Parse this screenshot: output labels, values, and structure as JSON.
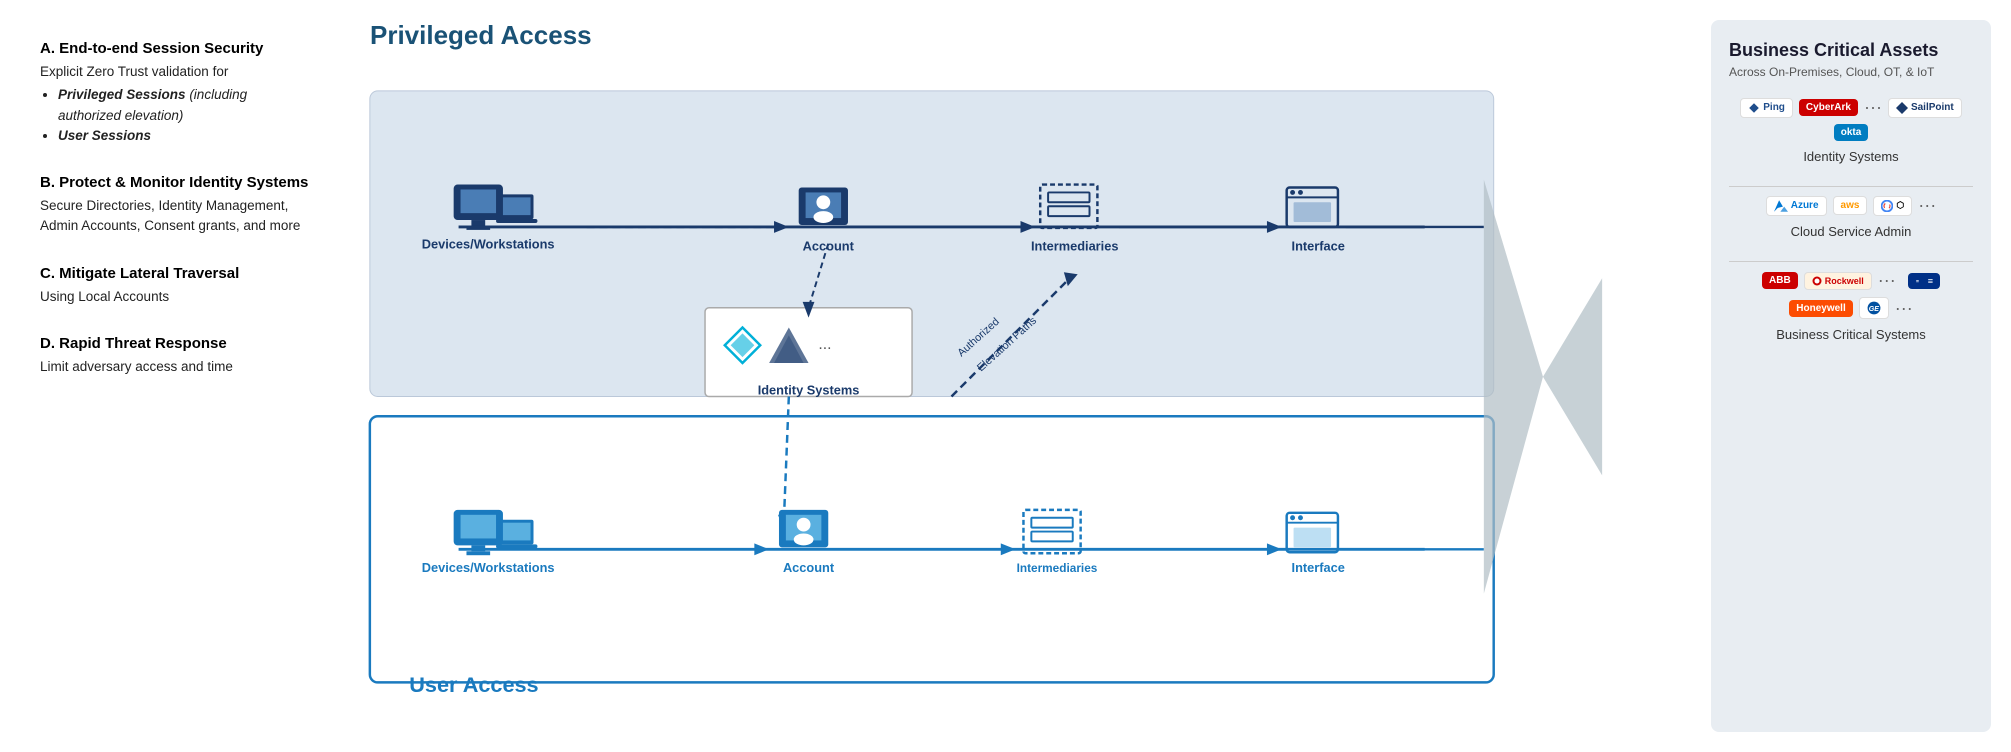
{
  "left": {
    "sections": [
      {
        "id": "A",
        "title": "A. End-to-end Session Security",
        "body": "Explicit Zero Trust validation for",
        "bullets": [
          "Privileged Sessions (including authorized elevation)",
          "User Sessions"
        ]
      },
      {
        "id": "B",
        "title": "B. Protect & Monitor Identity Systems",
        "body": "Secure Directories, Identity Management, Admin Accounts, Consent grants, and more",
        "bullets": []
      },
      {
        "id": "C",
        "title": "C. Mitigate Lateral Traversal",
        "body": "Using Local Accounts",
        "bullets": []
      },
      {
        "id": "D",
        "title": "D. Rapid Threat Response",
        "body": "Limit adversary access and time",
        "bullets": []
      }
    ]
  },
  "diagram": {
    "privileged_label": "Privileged Access",
    "user_label": "User Access",
    "privileged_row": {
      "nodes": [
        {
          "id": "priv-devices",
          "label": "Devices/Workstations"
        },
        {
          "id": "priv-account",
          "label": "Account"
        },
        {
          "id": "priv-intermediaries",
          "label": "Intermediaries"
        },
        {
          "id": "priv-interface",
          "label": "Interface"
        }
      ]
    },
    "user_row": {
      "nodes": [
        {
          "id": "user-devices",
          "label": "Devices/Workstations"
        },
        {
          "id": "user-account",
          "label": "Account"
        },
        {
          "id": "user-intermediaries",
          "label": "Intermediaries"
        },
        {
          "id": "user-interface",
          "label": "Interface"
        }
      ]
    },
    "identity_systems": "Identity Systems",
    "elevation_label": "Authorized Elevation Paths"
  },
  "bca": {
    "title": "Business Critical Assets",
    "subtitle": "Across On-Premises, Cloud, OT, & IoT",
    "groups": [
      {
        "id": "identity",
        "label": "Identity Systems",
        "logos": [
          "Ping",
          "CyberArk",
          "SailPoint",
          "okta",
          "..."
        ]
      },
      {
        "id": "cloud",
        "label": "Cloud Service Admin",
        "logos": [
          "Azure",
          "AWS",
          "Google",
          "..."
        ]
      },
      {
        "id": "bcs",
        "label": "Business Critical Systems",
        "logos": [
          "ABB",
          "Rockwell",
          "Honeywell",
          "GE",
          "..."
        ]
      }
    ]
  }
}
